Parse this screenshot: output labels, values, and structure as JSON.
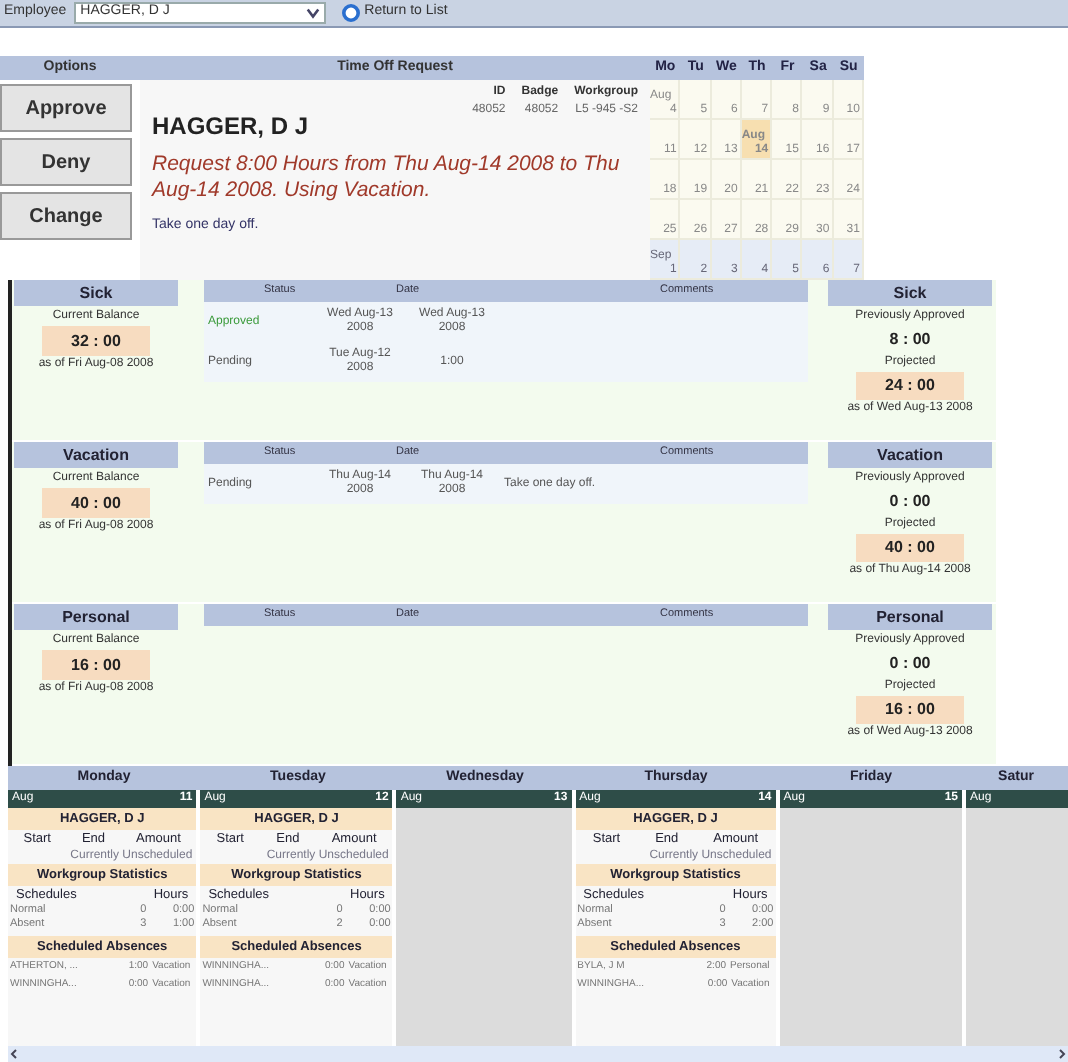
{
  "toolbar": {
    "employee_label": "Employee",
    "employee": "HAGGER, D J",
    "return_link": "Return to List"
  },
  "headers": {
    "options": "Options",
    "request": "Time Off Request"
  },
  "buttons": [
    "Approve",
    "Deny",
    "Change"
  ],
  "request": {
    "name": "HAGGER, D J",
    "fields": [
      {
        "label": "ID",
        "value": "48052"
      },
      {
        "label": "Badge",
        "value": "48052"
      },
      {
        "label": "Workgroup",
        "value": "L5 -945 -S2"
      }
    ],
    "message": "Request 8:00 Hours from Thu Aug-14 2008 to Thu Aug-14 2008. Using Vacation.",
    "comment": "Take one day off."
  },
  "mini_calendar": {
    "weekdays": [
      "Mo",
      "Tu",
      "We",
      "Th",
      "Fr",
      "Sa",
      "Su"
    ],
    "weeks": [
      [
        {
          "day": "4",
          "month": "Aug",
          "in_month": true,
          "selected": false
        },
        {
          "day": "5",
          "in_month": true,
          "selected": false
        },
        {
          "day": "6",
          "in_month": true,
          "selected": false
        },
        {
          "day": "7",
          "in_month": true,
          "selected": false
        },
        {
          "day": "8",
          "in_month": true,
          "selected": false
        },
        {
          "day": "9",
          "in_month": true,
          "selected": false
        },
        {
          "day": "10",
          "in_month": true,
          "selected": false
        }
      ],
      [
        {
          "day": "11",
          "in_month": true,
          "selected": false
        },
        {
          "day": "12",
          "in_month": true,
          "selected": false
        },
        {
          "day": "13",
          "in_month": true,
          "selected": false
        },
        {
          "day": "14",
          "month": "Aug",
          "in_month": true,
          "selected": true
        },
        {
          "day": "15",
          "in_month": true,
          "selected": false
        },
        {
          "day": "16",
          "in_month": true,
          "selected": false
        },
        {
          "day": "17",
          "in_month": true,
          "selected": false
        }
      ],
      [
        {
          "day": "18",
          "in_month": true,
          "selected": false
        },
        {
          "day": "19",
          "in_month": true,
          "selected": false
        },
        {
          "day": "20",
          "in_month": true,
          "selected": false
        },
        {
          "day": "21",
          "in_month": true,
          "selected": false
        },
        {
          "day": "22",
          "in_month": true,
          "selected": false
        },
        {
          "day": "23",
          "in_month": true,
          "selected": false
        },
        {
          "day": "24",
          "in_month": true,
          "selected": false
        }
      ],
      [
        {
          "day": "25",
          "in_month": true,
          "selected": false
        },
        {
          "day": "26",
          "in_month": true,
          "selected": false
        },
        {
          "day": "27",
          "in_month": true,
          "selected": false
        },
        {
          "day": "28",
          "in_month": true,
          "selected": false
        },
        {
          "day": "29",
          "in_month": true,
          "selected": false
        },
        {
          "day": "30",
          "in_month": true,
          "selected": false
        },
        {
          "day": "31",
          "in_month": true,
          "selected": false
        }
      ],
      [
        {
          "day": "1",
          "month": "Sep",
          "in_month": false,
          "selected": false
        },
        {
          "day": "2",
          "in_month": false,
          "selected": false
        },
        {
          "day": "3",
          "in_month": false,
          "selected": false
        },
        {
          "day": "4",
          "in_month": false,
          "selected": false
        },
        {
          "day": "5",
          "in_month": false,
          "selected": false
        },
        {
          "day": "6",
          "in_month": false,
          "selected": false
        },
        {
          "day": "7",
          "in_month": false,
          "selected": false
        }
      ]
    ]
  },
  "leave_sections": [
    {
      "type": "Sick",
      "balance_label": "Current Balance",
      "balance": "32 : 00",
      "balance_as_of": "as of Fri Aug-08 2008",
      "columns": [
        "Status",
        "Date",
        "Comments"
      ],
      "rows": [
        {
          "kind": "approved",
          "status": "Approved",
          "start": "Wed Aug-13 2008",
          "end": "Wed Aug-13 2008"
        },
        {
          "kind": "pending",
          "status": "Pending",
          "start": "Tue Aug-12 2008",
          "end": "1:00"
        }
      ],
      "right_title": "Sick",
      "approved_label": "Previously Approved",
      "approved": "8 : 00",
      "projected_label": "Projected",
      "projected": "24 : 00",
      "projected_as_of": "as of Wed Aug-13 2008"
    },
    {
      "type": "Vacation",
      "balance_label": "Current Balance",
      "balance": "40 : 00",
      "balance_as_of": "as of Fri Aug-08 2008",
      "columns": [
        "Status",
        "Date",
        "Comments"
      ],
      "rows": [
        {
          "kind": "pending",
          "status": "Pending",
          "start": "Thu Aug-14 2008",
          "end": "Thu Aug-14 2008",
          "comment": "Take one day off."
        }
      ],
      "right_title": "Vacation",
      "approved_label": "Previously Approved",
      "approved": "0 : 00",
      "projected_label": "Projected",
      "projected": "40 : 00",
      "projected_as_of": "as of Thu Aug-14 2008"
    },
    {
      "type": "Personal",
      "balance_label": "Current Balance",
      "balance": "16 : 00",
      "balance_as_of": "as of Fri Aug-08 2008",
      "columns": [
        "Status",
        "Date",
        "Comments"
      ],
      "right_title": "Personal",
      "approved_label": "Previously Approved",
      "approved": "0 : 00",
      "projected_label": "Projected",
      "projected": "16 : 00",
      "projected_as_of": "as of Wed Aug-13 2008"
    }
  ],
  "week": [
    {
      "weekday": "Monday",
      "month": "Aug",
      "date": "11",
      "entry": {
        "name": "HAGGER, D J",
        "columns": [
          "Start",
          "End",
          "Amount"
        ],
        "status": "Currently Unscheduled",
        "stats_title": "Workgroup Statistics",
        "stats_columns": [
          "Schedules",
          "Hours"
        ],
        "stats": [
          {
            "label": "Normal",
            "count": "0",
            "hours": "0:00"
          },
          {
            "label": "Absent",
            "count": "3",
            "hours": "1:00"
          }
        ],
        "absences_title": "Scheduled Absences",
        "absences": [
          {
            "name": "ATHERTON, ...",
            "hours": "1:00",
            "type": "Vacation"
          },
          {
            "name": "WINNINGHA...",
            "hours": "0:00",
            "type": "Vacation"
          }
        ]
      }
    },
    {
      "weekday": "Tuesday",
      "month": "Aug",
      "date": "12",
      "entry": {
        "name": "HAGGER, D J",
        "columns": [
          "Start",
          "End",
          "Amount"
        ],
        "status": "Currently Unscheduled",
        "stats_title": "Workgroup Statistics",
        "stats_columns": [
          "Schedules",
          "Hours"
        ],
        "stats": [
          {
            "label": "Normal",
            "count": "0",
            "hours": "0:00"
          },
          {
            "label": "Absent",
            "count": "2",
            "hours": "0:00"
          }
        ],
        "absences_title": "Scheduled Absences",
        "absences": [
          {
            "name": "WINNINGHA...",
            "hours": "0:00",
            "type": "Vacation"
          },
          {
            "name": "WINNINGHA...",
            "hours": "0:00",
            "type": "Vacation"
          }
        ]
      }
    },
    {
      "weekday": "Wednesday",
      "month": "Aug",
      "date": "13"
    },
    {
      "weekday": "Thursday",
      "month": "Aug",
      "date": "14",
      "entry": {
        "name": "HAGGER, D J",
        "columns": [
          "Start",
          "End",
          "Amount"
        ],
        "status": "Currently Unscheduled",
        "stats_title": "Workgroup Statistics",
        "stats_columns": [
          "Schedules",
          "Hours"
        ],
        "stats": [
          {
            "label": "Normal",
            "count": "0",
            "hours": "0:00"
          },
          {
            "label": "Absent",
            "count": "3",
            "hours": "2:00"
          }
        ],
        "absences_title": "Scheduled Absences",
        "absences": [
          {
            "name": "BYLA, J M",
            "hours": "2:00",
            "type": "Personal"
          },
          {
            "name": "WINNINGHA...",
            "hours": "0:00",
            "type": "Vacation"
          }
        ]
      }
    },
    {
      "weekday": "Friday",
      "month": "Aug",
      "date": "15"
    },
    {
      "weekday": "Satur",
      "month": "Aug"
    }
  ]
}
